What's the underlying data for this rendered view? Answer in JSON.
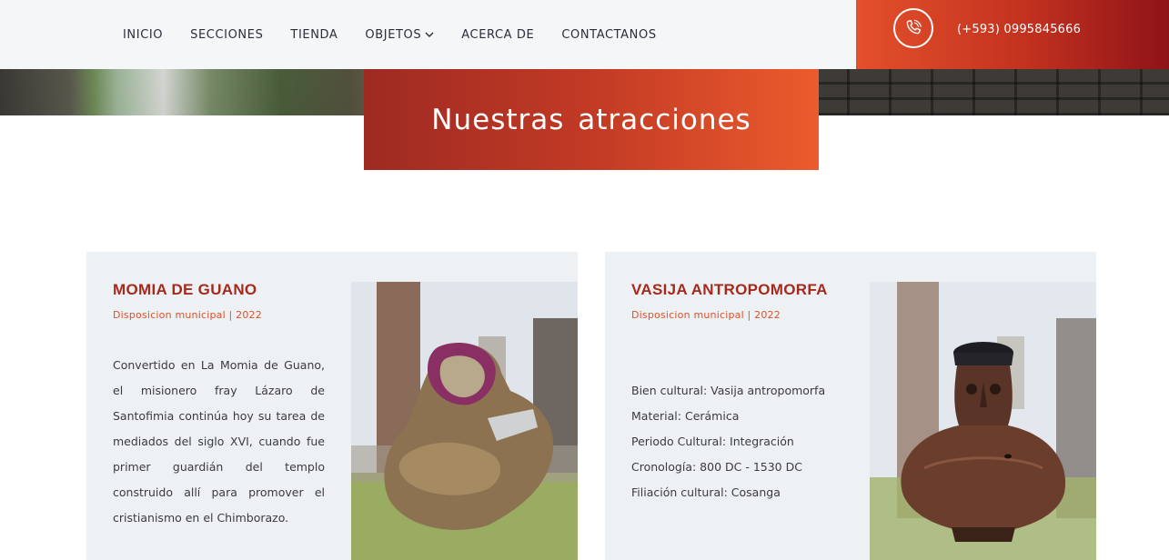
{
  "nav": {
    "items": [
      {
        "label": "INICIO"
      },
      {
        "label": "SECCIONES"
      },
      {
        "label": "TIENDA"
      },
      {
        "label": "OBJETOS",
        "has_dropdown": true
      },
      {
        "label": "ACERCA DE"
      },
      {
        "label": "CONTACTANOS"
      }
    ]
  },
  "contact": {
    "phone": "(+593) 0995845666",
    "icon": "phone-icon"
  },
  "banner": {
    "title": "Nuestras atracciones"
  },
  "cards": [
    {
      "title": "MOMIA DE GUANO",
      "subtitle": "Disposicion municipal | 2022",
      "description": "Convertido en La Momia de Guano, el misionero fray Lázaro de Santofimia continúa hoy su tarea de mediados del siglo XVI, cuando fue primer guardián del templo construido allí para promover el cristianismo en el Chimborazo.",
      "image": "mummy-photo"
    },
    {
      "title": "VASIJA ANTROPOMORFA",
      "subtitle": "Disposicion municipal | 2022",
      "specs": [
        "Bien cultural: Vasija antropomorfa",
        "Material: Cerámica",
        "Periodo Cultural: Integración",
        "Cronología: 800 DC - 1530 DC",
        "Filiación cultural: Cosanga"
      ],
      "image": "vessel-photo"
    }
  ],
  "colors": {
    "accent": "#e0502c",
    "title_red": "#a52a1e",
    "card_bg": "#edf1f3",
    "header_bg": "#f4f6f8"
  }
}
